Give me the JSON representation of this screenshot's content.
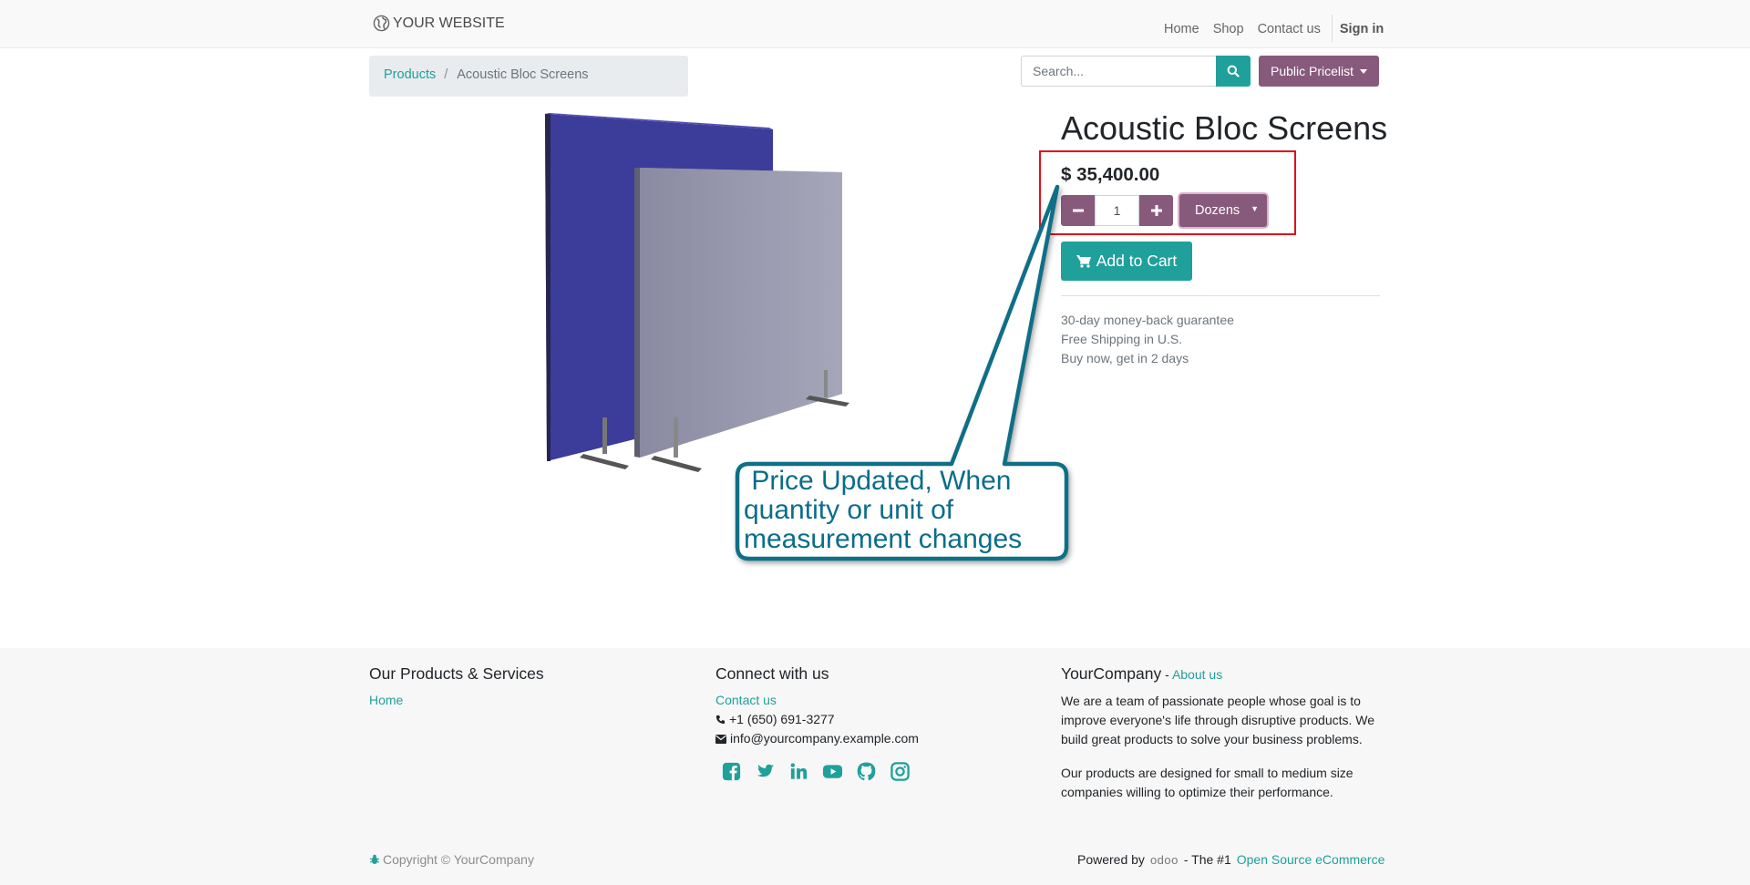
{
  "header": {
    "brand": "YOUR WEBSITE",
    "nav": [
      "Home",
      "Shop",
      "Contact us"
    ],
    "sign_in": "Sign in"
  },
  "breadcrumb": {
    "parent": "Products",
    "separator": "/",
    "current": "Acoustic Bloc Screens"
  },
  "search": {
    "placeholder": "Search..."
  },
  "pricelist": {
    "label": "Public Pricelist"
  },
  "product": {
    "title": "Acoustic Bloc Screens",
    "price": "$ 35,400.00",
    "quantity": "1",
    "uom": "Dozens",
    "add_to_cart": "Add to Cart",
    "perks": [
      "30-day money-back guarantee",
      "Free Shipping in U.S.",
      "Buy now, get in 2 days"
    ]
  },
  "callout": {
    "lines": [
      " Price Updated, When",
      "quantity or unit of",
      "measurement changes"
    ]
  },
  "footer": {
    "col1": {
      "title": "Our Products & Services",
      "link": "Home"
    },
    "col2": {
      "title": "Connect with us",
      "contact_link": "Contact us",
      "phone": "+1 (650) 691-3277",
      "email": "info@yourcompany.example.com",
      "socials": [
        "facebook-icon",
        "twitter-icon",
        "linkedin-icon",
        "youtube-icon",
        "github-icon",
        "instagram-icon"
      ]
    },
    "col3": {
      "title": "YourCompany",
      "dash": " - ",
      "about_link": "About us",
      "para1": "We are a team of passionate people whose goal is to improve everyone's life through disruptive products. We build great products to solve your business problems.",
      "para2": "Our products are designed for small to medium size companies willing to optimize their performance."
    },
    "copyright": "Copyright © YourCompany",
    "powered_by": "Powered by",
    "odoo": "odoo",
    "tagline": "- The #1",
    "tagline_link": "Open Source eCommerce"
  },
  "colors": {
    "accent_teal": "#20a09b",
    "accent_purple": "#875a7b",
    "callout_border": "#0f6f86",
    "highlight_red": "#e0101a"
  }
}
